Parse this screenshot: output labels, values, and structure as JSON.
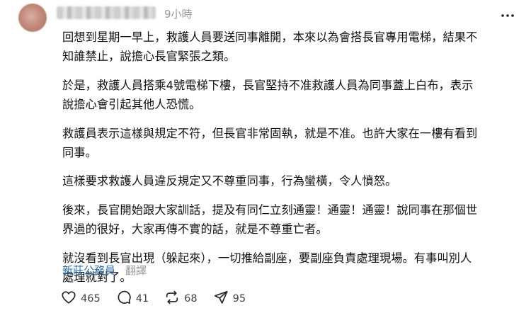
{
  "post": {
    "timestamp": "9小時",
    "paragraphs": [
      "回想到星期一早上，救護人員要送同事離開，本來以為會搭長官專用電梯，結果不\n知誰禁止，說擔心長官緊張之類。",
      "於是，救護人員搭乘4號電梯下樓，長官堅持不准救護人員為同事蓋上白布，表示\n說擔心會引起其他人恐慌。",
      "救護員表示這樣與規定不符，但長官非常固執，就是不准。也許大家在一樓有看到\n同事。",
      "這樣要求救護人員違反規定又不尊重同事，行為蠻橫，令人憤怒。",
      "後來，長官開始跟大家訓話，提及有同仁立刻通靈！通靈！通靈！說同事在那個世\n界過的很好，大家再傳不實的話，就是不尊重亡者。",
      "就沒看到長官出現（躲起來），一切推給副座，要副座負責處理現場。有事叫別人\n處理就對了。"
    ],
    "tag": "新莊公務員",
    "translate_label": "翻譯"
  },
  "actions": {
    "like_count": "465",
    "reply_count": "41",
    "repost_count": "68",
    "share_count": "95"
  },
  "icons": {
    "more": "more-horizontal-icon",
    "like": "heart-icon",
    "reply": "comment-bubble-icon",
    "repost": "repost-icon",
    "share": "send-icon"
  }
}
